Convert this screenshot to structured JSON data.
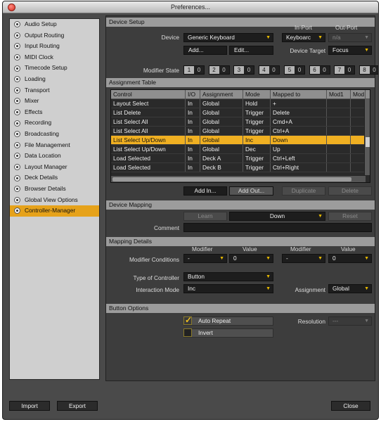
{
  "window": {
    "title": "Preferences..."
  },
  "sidebar": {
    "items": [
      {
        "label": "Audio Setup",
        "selected": false
      },
      {
        "label": "Output Routing",
        "selected": false
      },
      {
        "label": "Input Routing",
        "selected": false
      },
      {
        "label": "MIDI Clock",
        "selected": false
      },
      {
        "label": "Timecode Setup",
        "selected": false
      },
      {
        "label": "Loading",
        "selected": false
      },
      {
        "label": "Transport",
        "selected": false
      },
      {
        "label": "Mixer",
        "selected": false
      },
      {
        "label": "Effects",
        "selected": false
      },
      {
        "label": "Recording",
        "selected": false
      },
      {
        "label": "Broadcasting",
        "selected": false
      },
      {
        "label": "File Management",
        "selected": false
      },
      {
        "label": "Data Location",
        "selected": false
      },
      {
        "label": "Layout Manager",
        "selected": false
      },
      {
        "label": "Deck Details",
        "selected": false
      },
      {
        "label": "Browser Details",
        "selected": false
      },
      {
        "label": "Global View Options",
        "selected": false
      },
      {
        "label": "Controller-Manager",
        "selected": true
      }
    ]
  },
  "device_setup": {
    "section_title": "Device Setup",
    "device_label": "Device",
    "device_value": "Generic Keyboard",
    "in_port_label": "In-Port",
    "in_port_value": "Keyboarc",
    "out_port_label": "Out-Port",
    "out_port_value": "n/a",
    "add_label": "Add...",
    "edit_label": "Edit...",
    "device_target_label": "Device Target",
    "device_target_value": "Focus",
    "modifier_state_label": "Modifier State",
    "modifiers": [
      {
        "key": "1",
        "value": "0"
      },
      {
        "key": "2",
        "value": "0"
      },
      {
        "key": "3",
        "value": "0"
      },
      {
        "key": "4",
        "value": "0"
      },
      {
        "key": "5",
        "value": "0"
      },
      {
        "key": "6",
        "value": "0"
      },
      {
        "key": "7",
        "value": "0"
      },
      {
        "key": "8",
        "value": "0"
      }
    ]
  },
  "assignment_table": {
    "section_title": "Assignment Table",
    "columns": [
      "Control",
      "I/O",
      "Assignment",
      "Mode",
      "Mapped to",
      "Mod1",
      "Mod"
    ],
    "rows": [
      {
        "control": "Layout Select",
        "io": "In",
        "assignment": "Global",
        "mode": "Hold",
        "mapped": "+",
        "selected": false
      },
      {
        "control": "List Delete",
        "io": "In",
        "assignment": "Global",
        "mode": "Trigger",
        "mapped": "Delete",
        "selected": false
      },
      {
        "control": "List Select All",
        "io": "In",
        "assignment": "Global",
        "mode": "Trigger",
        "mapped": "Cmd+A",
        "selected": false
      },
      {
        "control": "List Select All",
        "io": "In",
        "assignment": "Global",
        "mode": "Trigger",
        "mapped": "Ctrl+A",
        "selected": false
      },
      {
        "control": "List Select Up/Down",
        "io": "In",
        "assignment": "Global",
        "mode": "Inc",
        "mapped": "Down",
        "selected": true
      },
      {
        "control": "List Select Up/Down",
        "io": "In",
        "assignment": "Global",
        "mode": "Dec",
        "mapped": "Up",
        "selected": false
      },
      {
        "control": "Load Selected",
        "io": "In",
        "assignment": "Deck A",
        "mode": "Trigger",
        "mapped": "Ctrl+Left",
        "selected": false
      },
      {
        "control": "Load Selected",
        "io": "In",
        "assignment": "Deck B",
        "mode": "Trigger",
        "mapped": "Ctrl+Right",
        "selected": false
      }
    ],
    "add_in_label": "Add In...",
    "add_out_label": "Add Out...",
    "duplicate_label": "Duplicate",
    "delete_label": "Delete"
  },
  "device_mapping": {
    "section_title": "Device Mapping",
    "learn_label": "Learn",
    "key_value": "Down",
    "reset_label": "Reset",
    "comment_label": "Comment",
    "comment_value": ""
  },
  "mapping_details": {
    "section_title": "Mapping Details",
    "modifier_header": "Modifier",
    "value_header": "Value",
    "modifier_conditions_label": "Modifier Conditions",
    "cond1_modifier": "-",
    "cond1_value": "0",
    "cond2_modifier": "-",
    "cond2_value": "0",
    "type_label": "Type of Controller",
    "type_value": "Button",
    "interaction_label": "Interaction Mode",
    "interaction_value": "Inc",
    "assignment_label": "Assignment",
    "assignment_value": "Global"
  },
  "button_options": {
    "section_title": "Button Options",
    "auto_repeat_label": "Auto Repeat",
    "auto_repeat_checked": true,
    "invert_label": "Invert",
    "invert_checked": false,
    "resolution_label": "Resolution",
    "resolution_value": "---"
  },
  "footer": {
    "import_label": "Import",
    "export_label": "Export",
    "close_label": "Close"
  }
}
